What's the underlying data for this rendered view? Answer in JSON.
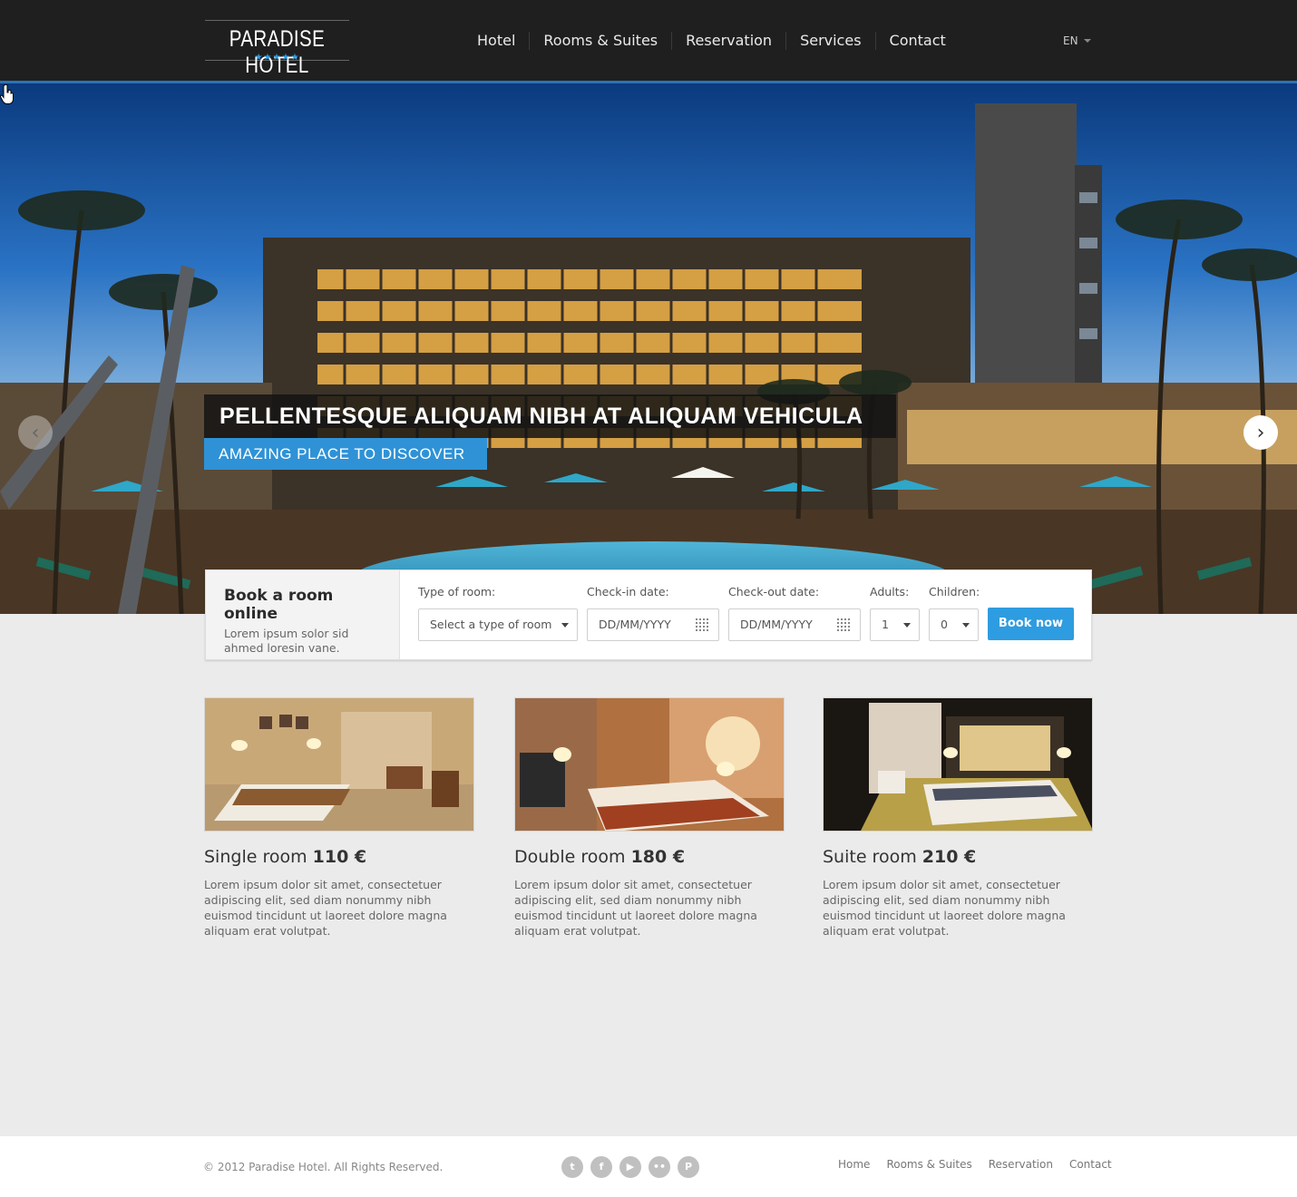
{
  "header": {
    "logo_text": "PARADISE HOTEL",
    "logo_stars": "★★★★★",
    "nav": [
      "Hotel",
      "Rooms & Suites",
      "Reservation",
      "Services",
      "Contact"
    ],
    "language": "EN"
  },
  "hero": {
    "title": "PELLENTESQUE ALIQUAM NIBH AT ALIQUAM VEHICULA",
    "subtitle": "AMAZING PLACE TO DISCOVER",
    "prev_glyph": "‹",
    "next_glyph": "›"
  },
  "booking": {
    "title": "Book a room online",
    "description": "Lorem ipsum solor sid ahmed loresin vane.",
    "room_type_label": "Type of room:",
    "room_type_value": "Select a type of room",
    "checkin_label": "Check-in date:",
    "checkin_placeholder": "DD/MM/YYYY",
    "checkout_label": "Check-out date:",
    "checkout_placeholder": "DD/MM/YYYY",
    "adults_label": "Adults:",
    "adults_value": "1",
    "children_label": "Children:",
    "children_value": "0",
    "button": "Book now"
  },
  "rooms": [
    {
      "name": "Single room",
      "price": "110 €",
      "description": "Lorem ipsum dolor sit amet, consectetuer adipiscing elit, sed diam nonummy nibh euismod tincidunt ut laoreet dolore magna aliquam erat volutpat."
    },
    {
      "name": "Double room",
      "price": "180 €",
      "description": "Lorem ipsum dolor sit amet, consectetuer adipiscing elit, sed diam nonummy nibh euismod tincidunt ut laoreet dolore magna aliquam erat volutpat."
    },
    {
      "name": "Suite room",
      "price": "210 €",
      "description": "Lorem ipsum dolor sit amet, consectetuer adipiscing elit, sed diam nonummy nibh euismod tincidunt ut laoreet dolore magna aliquam erat volutpat."
    }
  ],
  "footer": {
    "copyright": "© 2012 Paradise Hotel. All Rights Reserved.",
    "social": [
      {
        "icon": "twitter-icon",
        "glyph": "t"
      },
      {
        "icon": "facebook-icon",
        "glyph": "f"
      },
      {
        "icon": "youtube-icon",
        "glyph": "▶"
      },
      {
        "icon": "flickr-icon",
        "glyph": "••"
      },
      {
        "icon": "pinterest-icon",
        "glyph": "P"
      }
    ],
    "nav": [
      "Home",
      "Rooms & Suites",
      "Reservation",
      "Contact"
    ]
  },
  "colors": {
    "accent": "#2e9ce0",
    "header_bg": "#1f1f1f",
    "page_bg": "#ebebeb"
  }
}
